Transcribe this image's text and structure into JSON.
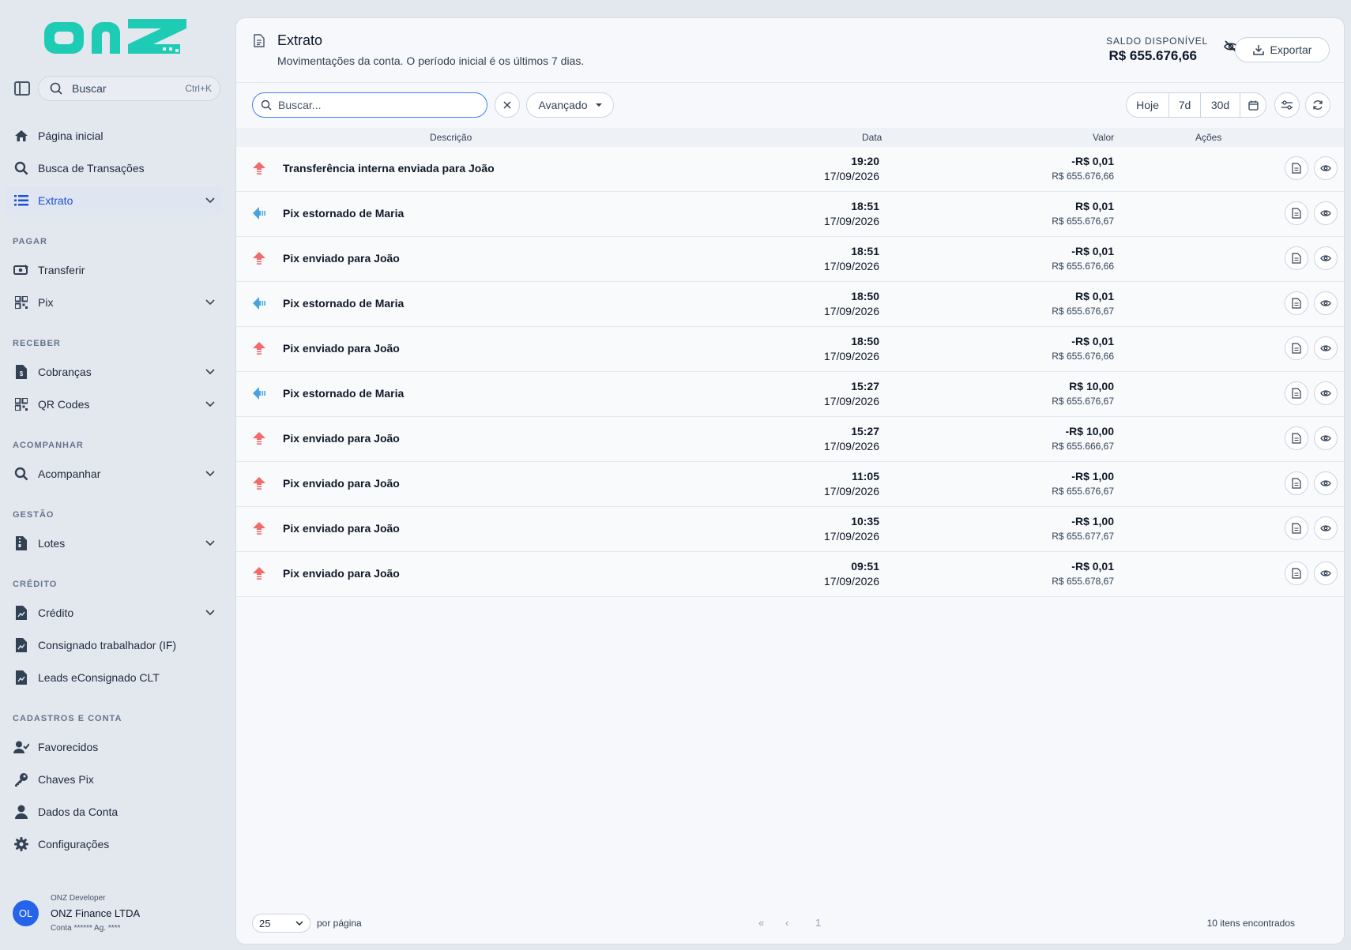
{
  "sidebar": {
    "search": {
      "label": "Buscar",
      "shortcut": "Ctrl+K"
    },
    "items": [
      {
        "label": "Página inicial",
        "icon": "home-icon"
      },
      {
        "label": "Busca de Transações",
        "icon": "search-icon"
      },
      {
        "label": "Extrato",
        "icon": "list-icon",
        "active": true
      }
    ],
    "sections": {
      "pagar": "PAGAR",
      "receber": "RECEBER",
      "acompanhar": "ACOMPANHAR",
      "gestao": "GESTÃO",
      "credito": "CRÉDITO",
      "cadastros": "CADASTROS E CONTA"
    },
    "pagar_items": [
      {
        "label": "Transferir",
        "icon": "money-transfer-icon"
      },
      {
        "label": "Pix",
        "icon": "qr-grid-icon"
      }
    ],
    "receber_items": [
      {
        "label": "Cobranças",
        "icon": "invoice-dollar-icon"
      },
      {
        "label": "QR Codes",
        "icon": "qr-grid-icon"
      }
    ],
    "acompanhar_items": [
      {
        "label": "Acompanhar",
        "icon": "search-icon"
      }
    ],
    "gestao_items": [
      {
        "label": "Lotes",
        "icon": "file-zip-icon"
      }
    ],
    "credito_items": [
      {
        "label": "Crédito",
        "icon": "file-chart-icon"
      },
      {
        "label": "Consignado trabalhador (IF)",
        "icon": "file-chart-icon"
      },
      {
        "label": "Leads eConsignado CLT",
        "icon": "file-chart-icon"
      }
    ],
    "cadastros_items": [
      {
        "label": "Favorecidos",
        "icon": "user-check-icon"
      },
      {
        "label": "Chaves Pix",
        "icon": "key-icon"
      },
      {
        "label": "Dados da Conta",
        "icon": "user-icon"
      },
      {
        "label": "Configurações",
        "icon": "gear-icon"
      }
    ],
    "user": {
      "initials": "OL",
      "role": "ONZ Developer",
      "company": "ONZ Finance LTDA",
      "account": "Conta ****** Ag. ****"
    }
  },
  "header": {
    "title": "Extrato",
    "subtitle": "Movimentações da conta. O período inicial é os últimos 7 dias.",
    "balance_label": "SALDO DISPONÍVEL",
    "balance_value": "R$ 655.676,66",
    "export_label": "Exportar"
  },
  "toolbar": {
    "search_placeholder": "Buscar...",
    "advanced_label": "Avançado",
    "periods": [
      "Hoje",
      "7d",
      "30d"
    ]
  },
  "table": {
    "columns": {
      "descricao": "Descrição",
      "data": "Data",
      "valor": "Valor",
      "acoes": "Ações"
    },
    "rows": [
      {
        "direction": "out",
        "desc": "Transferência interna enviada para João",
        "time": "19:20",
        "date": "17/09/2026",
        "amount": "-R$ 0,01",
        "balance": "R$ 655.676,66"
      },
      {
        "direction": "in",
        "desc": "Pix estornado de Maria",
        "time": "18:51",
        "date": "17/09/2026",
        "amount": "R$ 0,01",
        "balance": "R$ 655.676,67"
      },
      {
        "direction": "out",
        "desc": "Pix enviado para João",
        "time": "18:51",
        "date": "17/09/2026",
        "amount": "-R$ 0,01",
        "balance": "R$ 655.676,66"
      },
      {
        "direction": "in",
        "desc": "Pix estornado de Maria",
        "time": "18:50",
        "date": "17/09/2026",
        "amount": "R$ 0,01",
        "balance": "R$ 655.676,67"
      },
      {
        "direction": "out",
        "desc": "Pix enviado para João",
        "time": "18:50",
        "date": "17/09/2026",
        "amount": "-R$ 0,01",
        "balance": "R$ 655.676,66"
      },
      {
        "direction": "in",
        "desc": "Pix estornado de Maria",
        "time": "15:27",
        "date": "17/09/2026",
        "amount": "R$ 10,00",
        "balance": "R$ 655.676,67"
      },
      {
        "direction": "out",
        "desc": "Pix enviado para João",
        "time": "15:27",
        "date": "17/09/2026",
        "amount": "-R$ 10,00",
        "balance": "R$ 655.666,67"
      },
      {
        "direction": "out",
        "desc": "Pix enviado para João",
        "time": "11:05",
        "date": "17/09/2026",
        "amount": "-R$ 1,00",
        "balance": "R$ 655.676,67"
      },
      {
        "direction": "out",
        "desc": "Pix enviado para João",
        "time": "10:35",
        "date": "17/09/2026",
        "amount": "-R$ 1,00",
        "balance": "R$ 655.677,67"
      },
      {
        "direction": "out",
        "desc": "Pix enviado para João",
        "time": "09:51",
        "date": "17/09/2026",
        "amount": "-R$ 0,01",
        "balance": "R$ 655.678,67"
      }
    ]
  },
  "footer": {
    "per_page_value": "25",
    "per_page_label": "por página",
    "first_page": "«",
    "prev_page": "‹",
    "current_page": "1",
    "found_label": "10 itens encontrados"
  },
  "colors": {
    "brand": "#1ecbb4",
    "accent": "#2563eb",
    "out_arrow": "#f26a6a",
    "in_arrow": "#4aa3df"
  }
}
